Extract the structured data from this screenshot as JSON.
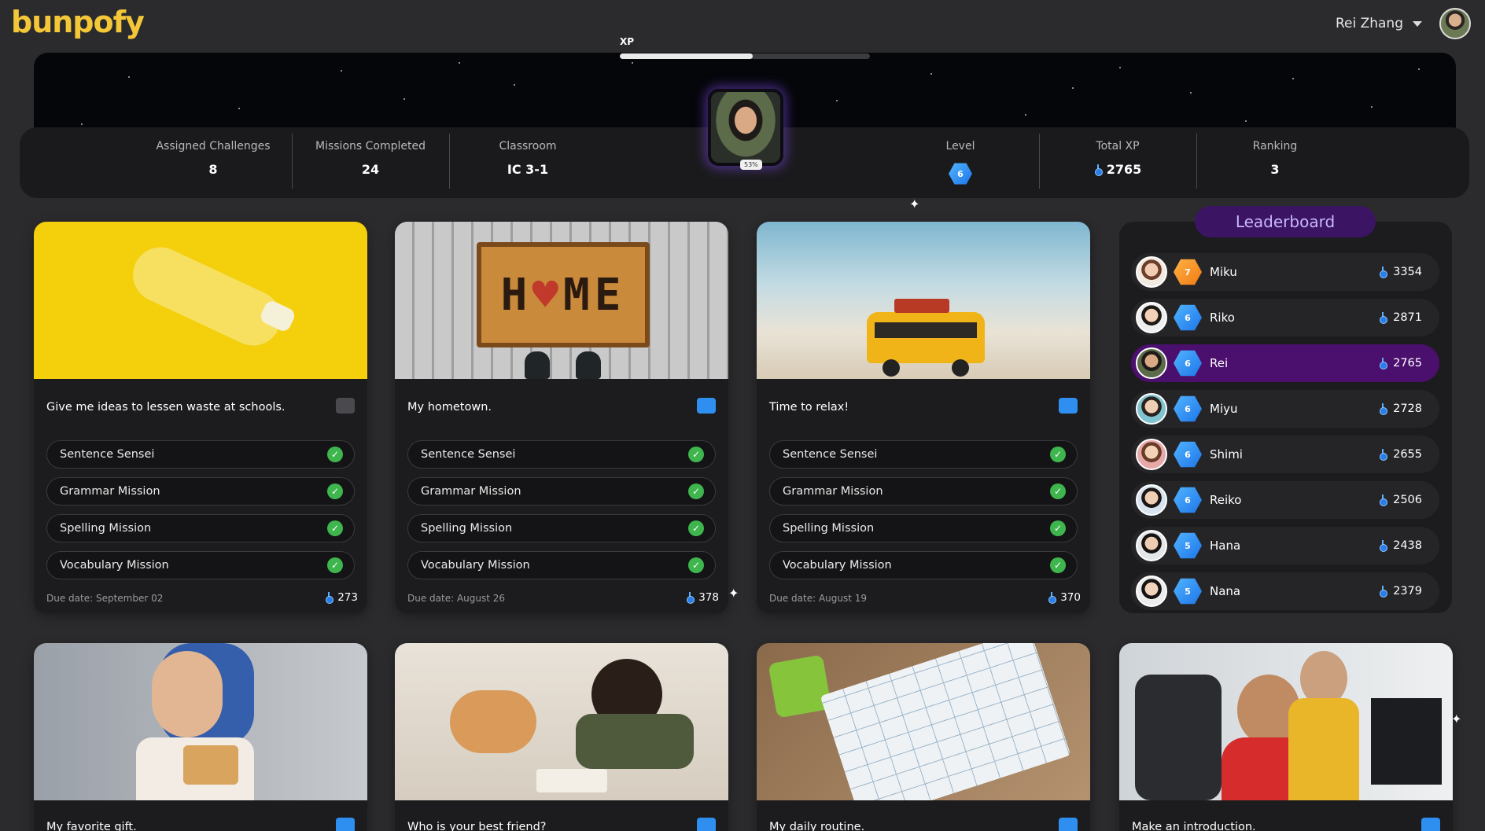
{
  "app": {
    "logo_text": "bunpofy",
    "brand_color": "#f3c737"
  },
  "user": {
    "name": "Rei Zhang",
    "menu_icon": "chevron-down-icon"
  },
  "stats": {
    "assigned_label": "Assigned Challenges",
    "assigned_value": "8",
    "missions_label": "Missions Completed",
    "missions_value": "24",
    "classroom_label": "Classroom",
    "classroom_value": "IC 3-1",
    "xp_label": "XP",
    "xp_progress": 0.53,
    "xp_percent_text": "53%",
    "level_label": "Level",
    "level_value": "6",
    "total_xp_label": "Total XP",
    "total_xp_value": "2765",
    "ranking_label": "Ranking",
    "ranking_value": "3"
  },
  "cards": [
    {
      "title": "Give me ideas to lessen waste at schools.",
      "due": "Due date: September 02",
      "xp": "273",
      "icon_active": false
    },
    {
      "title": "My hometown.",
      "due": "Due date: August 26",
      "xp": "378",
      "icon_active": true
    },
    {
      "title": "Time to relax!",
      "due": "Due date: August 19",
      "xp": "370",
      "icon_active": true
    }
  ],
  "missions": [
    "Sentence Sensei",
    "Grammar Mission",
    "Spelling Mission",
    "Vocabulary Mission"
  ],
  "bottom_cards": [
    {
      "title": "My favorite gift."
    },
    {
      "title": "Who is your best friend?"
    },
    {
      "title": "My daily routine."
    },
    {
      "title": "Make an introduction."
    }
  ],
  "leaderboard": {
    "title": "Leaderboard",
    "rows": [
      {
        "name": "Miku",
        "level": "7",
        "xp": "3354",
        "me": false,
        "level_color": "orange"
      },
      {
        "name": "Riko",
        "level": "6",
        "xp": "2871",
        "me": false,
        "level_color": "blue"
      },
      {
        "name": "Rei",
        "level": "6",
        "xp": "2765",
        "me": true,
        "level_color": "blue"
      },
      {
        "name": "Miyu",
        "level": "6",
        "xp": "2728",
        "me": false,
        "level_color": "blue"
      },
      {
        "name": "Shimi",
        "level": "6",
        "xp": "2655",
        "me": false,
        "level_color": "blue"
      },
      {
        "name": "Reiko",
        "level": "6",
        "xp": "2506",
        "me": false,
        "level_color": "blue"
      },
      {
        "name": "Hana",
        "level": "5",
        "xp": "2438",
        "me": false,
        "level_color": "blue"
      },
      {
        "name": "Nana",
        "level": "5",
        "xp": "2379",
        "me": false,
        "level_color": "blue"
      }
    ]
  }
}
